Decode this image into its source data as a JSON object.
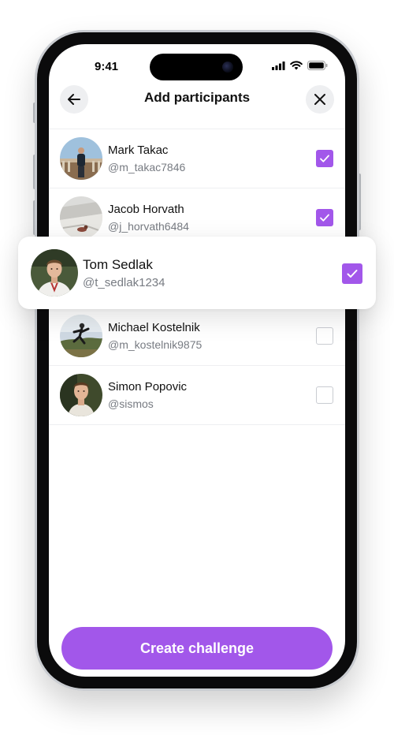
{
  "status_bar": {
    "time": "9:41"
  },
  "header": {
    "title": "Add participants",
    "back_icon": "arrow-left-icon",
    "close_icon": "close-icon"
  },
  "accent_color": "#a257ea",
  "participants": [
    {
      "name": "Mark Takac",
      "handle": "@m_takac7846",
      "selected": true
    },
    {
      "name": "Jacob Horvath",
      "handle": "@j_horvath6484",
      "selected": true
    },
    {
      "name": "Tom Sedlak",
      "handle": "@t_sedlak1234",
      "selected": true
    },
    {
      "name": "Michael Kostelnik",
      "handle": "@m_kostelnik9875",
      "selected": false
    },
    {
      "name": "Simon Popovic",
      "handle": "@sismos",
      "selected": false
    }
  ],
  "cta": {
    "label": "Create challenge"
  }
}
